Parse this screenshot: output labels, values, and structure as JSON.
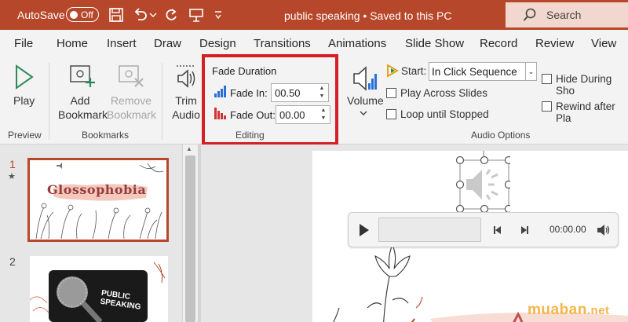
{
  "titlebar": {
    "autosave_label": "AutoSave",
    "autosave_state": "Off",
    "document_title": "public speaking • Saved to this PC",
    "search_label": "Search"
  },
  "menu": {
    "tabs": [
      "File",
      "Home",
      "Insert",
      "Draw",
      "Design",
      "Transitions",
      "Animations",
      "Slide Show",
      "Record",
      "Review",
      "View"
    ]
  },
  "ribbon": {
    "play_label": "Play",
    "add_bookmark_label": [
      "Add",
      "Bookmark"
    ],
    "remove_bookmark_label": [
      "Remove",
      "Bookmark"
    ],
    "trim_audio_label": [
      "Trim",
      "Audio"
    ],
    "fade_duration_title": "Fade Duration",
    "fade_in_label": "Fade In:",
    "fade_in_value": "00.50",
    "fade_out_label": "Fade Out:",
    "fade_out_value": "00.00",
    "volume_label": "Volume",
    "start_label": "Start:",
    "start_value": "In Click Sequence",
    "play_across_slides": "Play Across Slides",
    "loop_until_stopped": "Loop until Stopped",
    "hide_during_show": "Hide During Sho",
    "rewind_after_playing": "Rewind after Pla",
    "groups": {
      "preview": "Preview",
      "bookmarks": "Bookmarks",
      "editing": "Editing",
      "audio_options": "Audio Options"
    }
  },
  "slides": {
    "items": [
      {
        "number": "1",
        "title": "Glossophobia"
      },
      {
        "number": "2",
        "title": "PUBLIC SPEAKING"
      }
    ]
  },
  "player": {
    "time": "00:00.00"
  },
  "watermark": {
    "brand": "muaban",
    "tld": ".net"
  },
  "colors": {
    "titlebar": "#b7472a",
    "highlight_box": "#d41f24",
    "accent_blue": "#2a6fd6",
    "accent_red": "#d13438",
    "watermark": "#f6b54a"
  }
}
